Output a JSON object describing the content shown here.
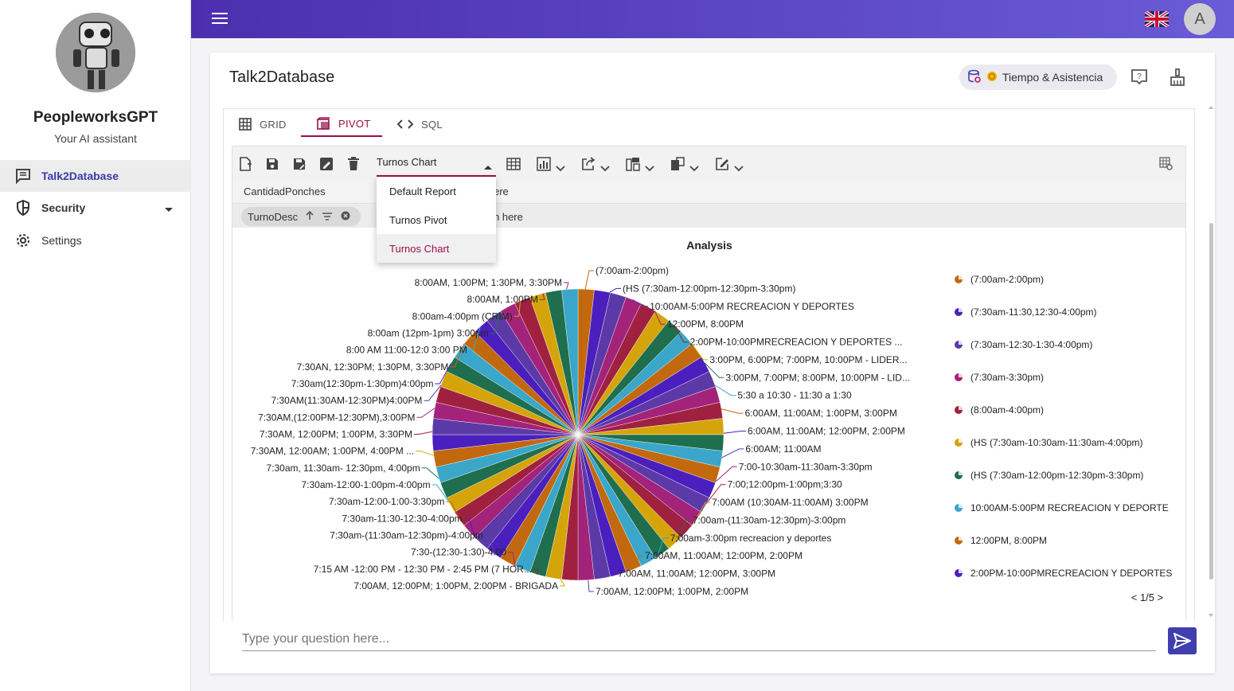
{
  "sidebar": {
    "brand_title": "PeopleworksGPT",
    "brand_subtitle": "Your AI assistant",
    "items": [
      {
        "label": "Talk2Database",
        "icon": "chat-icon"
      },
      {
        "label": "Security",
        "icon": "shield-icon"
      },
      {
        "label": "Settings",
        "icon": "gear-icon"
      }
    ]
  },
  "topbar": {
    "user_initial": "A",
    "flag": "uk-flag-icon"
  },
  "header": {
    "title": "Talk2Database",
    "database_chip": "Tiempo & Asistencia"
  },
  "tabs": [
    {
      "label": "GRID",
      "icon": "grid-icon"
    },
    {
      "label": "PIVOT",
      "icon": "pivot-icon"
    },
    {
      "label": "SQL",
      "icon": "code-icon"
    }
  ],
  "toolbar": {
    "report_value": "Turnos Chart",
    "report_options": [
      "Default Report",
      "Turnos Pivot",
      "Turnos Chart"
    ]
  },
  "fields": {
    "values_field": "CantidadPonches",
    "drop_hint_1": "ere",
    "row_chip": "TurnoDesc",
    "drop_hint_2": "n here"
  },
  "chat": {
    "placeholder": "Type your question here..."
  },
  "chart_data": {
    "type": "pie",
    "title": "Analysis",
    "slice_count": 56,
    "palette": [
      "#c2690f",
      "#4a1fbd",
      "#5b3aa8",
      "#a3237a",
      "#a0213f",
      "#d4a40a",
      "#1f6e4e",
      "#3aa6c9"
    ],
    "left_labels": [
      "8:00AM, 1:00PM; 1:30PM, 3:30PM",
      "8:00AM, 1:00PM",
      "8:00am-4:00pm (CRIM)",
      "8:00am (12pm-1pm) 3:00pm",
      "8:00 AM 11:00-12:0 3:00 PM",
      "7:30AN, 12:30PM; 1:30PM, 3:30PM",
      "7:30am(12:30pm-1:30pm)4:00pm",
      "7:30AM(11:30AM-12:30PM)4:00PM",
      "7:30AM,(12:00PM-12:30PM),3:00PM",
      "7:30AM, 12:00PM; 1:00PM, 3:30PM",
      "7:30AM, 12:00AM; 1:00PM, 4:00PM ...",
      "7:30am, 11:30am- 12:30pm, 4:00pm",
      "7:30am-12:00-1:00pm-4:00pm",
      "7:30am-12:00-1:00-3:30pm",
      "7:30am-11:30-12:30-4:00pm",
      "7:30am-(11:30am-12:30pm)-4:00pm",
      "7:30-(12:30-1:30)-4:00",
      "7:15 AM -12:00 PM - 12:30 PM - 2:45 PM (7 HOR...",
      "7:00AM, 12:00PM; 1:00PM, 2:00PM - BRIGADA"
    ],
    "right_labels": [
      "(7:00am-2:00pm)",
      "(HS (7:30am-12:00pm-12:30pm-3:30pm)",
      "10:00AM-5:00PM RECREACION Y DEPORTES",
      "12:00PM, 8:00PM",
      "2:00PM-10:00PMRECREACION Y DEPORTES ...",
      "3:00PM, 6:00PM; 7:00PM, 10:00PM - LIDER...",
      "3:00PM, 7:00PM; 8:00PM, 10:00PM - LID...",
      "5:30 a 10:30 - 11:30 a 1:30",
      "6:00AM, 11:00AM; 1:00PM, 3:00PM",
      "6:00AM, 11:00AM; 12:00PM, 2:00PM",
      "6:00AM; 11:00AM",
      "7:00-10:30am-11:30am-3:30pm",
      "7:00;12:00pm-1:00pm;3:30",
      "7:00AM (10:30AM-11:00AM) 3:00PM",
      "7:00am-(11:30am-12:30pm)-3:00pm",
      "7:00am-3:00pm recreacion y deportes",
      "7:00AM, 11:00AM; 12:00PM, 2:00PM",
      "7:00AM, 11:00AM; 12:00PM, 3:00PM",
      "7:00AM, 12:00PM; 1:00PM, 2:00PM"
    ],
    "legend": [
      {
        "label": "(7:00am-2:00pm)",
        "color": "#c2690f"
      },
      {
        "label": "(7:30am-11:30,12:30-4:00pm)",
        "color": "#4a1fbd"
      },
      {
        "label": "(7:30am-12:30-1:30-4:00pm)",
        "color": "#5b3aa8"
      },
      {
        "label": "(7:30am-3:30pm)",
        "color": "#a3237a"
      },
      {
        "label": "(8:00am-4:00pm)",
        "color": "#a0213f"
      },
      {
        "label": "(HS (7:30am-10:30am-11:30am-4:00pm)",
        "color": "#d4a40a"
      },
      {
        "label": "(HS (7:30am-12:00pm-12:30pm-3:30pm)",
        "color": "#1f6e4e"
      },
      {
        "label": "10:00AM-5:00PM RECREACION Y DEPORTE",
        "color": "#3aa6c9"
      },
      {
        "label": "12:00PM, 8:00PM",
        "color": "#c2690f"
      },
      {
        "label": "2:00PM-10:00PMRECREACION Y DEPORTES",
        "color": "#4a1fbd"
      }
    ],
    "legend_page": "1/5",
    "legend_placement": "right"
  }
}
